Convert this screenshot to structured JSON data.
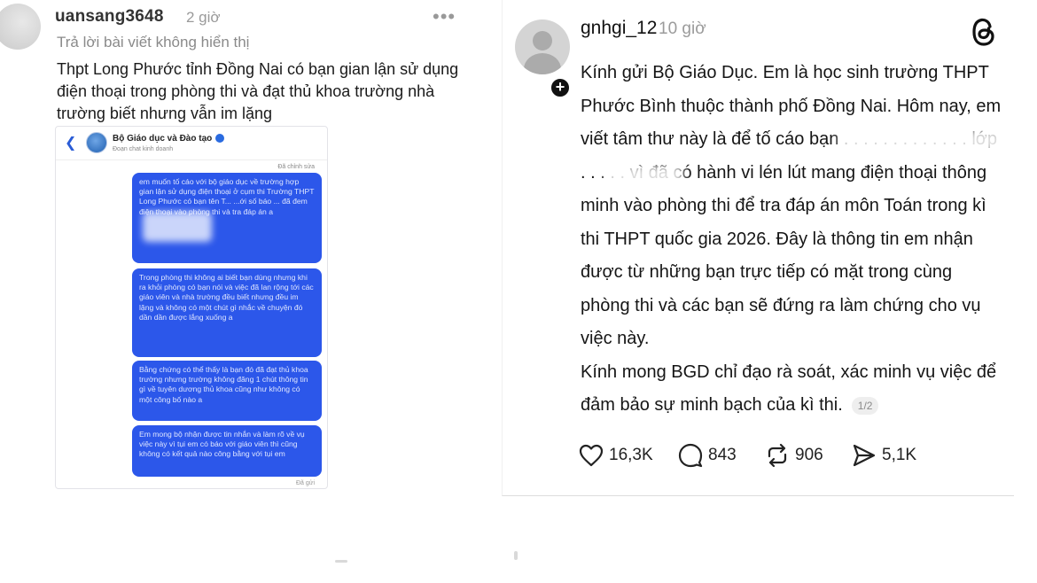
{
  "left_post": {
    "username": "uansang3648",
    "time": "2 giờ",
    "reply_note": "Trả lời bài viết không hiển thị",
    "text": "Thpt Long Phước tỉnh Đồng Nai có bạn gian lận sử dụng điện thoại trong phòng thi và đạt thủ khoa trường nhà trường biết nhưng vẫn im lặng",
    "more_icon": "more-icon"
  },
  "chat": {
    "contact_name": "Bộ Giáo dục và Đào tạo",
    "contact_subtitle": "Đoạn chat kinh doanh",
    "edited_label": "Đã chỉnh sửa",
    "sent_label": "Đã gửi",
    "messages": [
      "em muốn tố cáo với bộ giáo dục về trường hợp gian lận sử dụng điện thoại ở cụm thi Trường THPT Long Phước có bạn tên T... ...ới số báo ... đã đem điện thoại vào phòng thi và tra đáp án a",
      "Trong phòng thi không ai biết bạn dùng nhưng khi ra khỏi phòng có bạn nói và việc đã lan rộng tới các giáo viên và nhà trường đều biết nhưng đều im lặng và không có một chút gì nhắc về chuyện đó dần dần được lắng xuống a",
      "Bằng chứng có thể thấy là bạn đó đã đạt thủ khoa trường nhưng trường không đăng 1 chút thông tin gì về tuyên dương thủ khoa cũng như không có một công bố nào a",
      "Em mong bộ nhận được tin nhắn và làm rõ về vụ việc này vì tụi em có báo với giáo viên thì cũng không có kết quả nào công bằng với tụi em"
    ]
  },
  "right_post": {
    "username": "gnhgi_12",
    "time": "10 giờ",
    "paragraph_1": "Kính gửi Bộ Giáo Dục. Em là học sinh trường THPT Phước Bình thuộc thành phố Đồng Nai. Hôm nay, em viết tâm thư này là để tố cáo bạn . . . . . . . . . . . . . lớp . . . . . vì đã có hành vi lén lút mang điện thoại thông minh vào phòng thi để tra đáp án môn Toán trong kì thi THPT quốc gia 2026. Đây là thông tin em nhận được từ những bạn trực tiếp có mặt trong cùng phòng thi và các bạn sẽ đứng ra làm chứng cho vụ việc này.",
    "paragraph_2": "Kính mong BGD chỉ đạo rà soát, xác minh vụ việc để đảm bảo sự minh bạch của kì thi.",
    "page_indicator": "1/2",
    "actions": {
      "likes": "16,3K",
      "comments": "843",
      "reposts": "906",
      "shares": "5,1K"
    }
  }
}
